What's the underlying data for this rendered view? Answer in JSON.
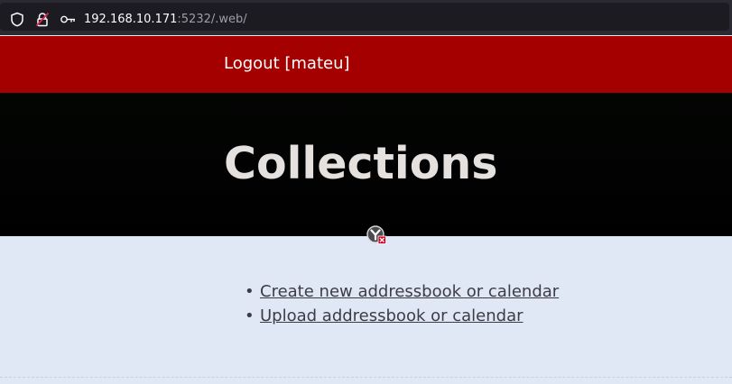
{
  "browser": {
    "url_host": "192.168.10.171",
    "url_rest": ":5232/.web/",
    "icons": [
      "shield-icon",
      "insecure-lock-icon",
      "key-icon"
    ]
  },
  "header": {
    "logout_label": "Logout [mateu]"
  },
  "main": {
    "title": "Collections",
    "actions": [
      {
        "label": "Create new addressbook or calendar"
      },
      {
        "label": "Upload addressbook or calendar"
      }
    ]
  },
  "colors": {
    "header_red": "#a40000",
    "hero_black": "#000000",
    "content_bg": "#e1e8f5",
    "title_text": "#e4e1de"
  }
}
